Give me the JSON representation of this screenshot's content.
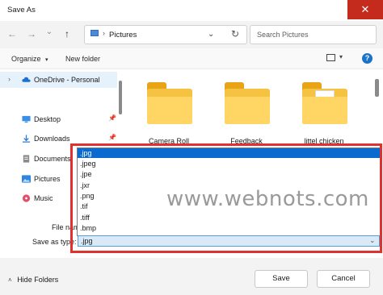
{
  "window": {
    "title": "Save As",
    "close_glyph": "✕"
  },
  "nav": {
    "back_glyph": "←",
    "forward_glyph": "→",
    "history_glyph": "⌄",
    "up_glyph": "↑",
    "address": {
      "separator": "›",
      "current": "Pictures",
      "dropdown_glyph": "⌄",
      "refresh_glyph": "↻"
    },
    "search": {
      "placeholder": "Search Pictures"
    }
  },
  "toolbar": {
    "organize": "Organize",
    "organize_caret": "▾",
    "new_folder": "New folder",
    "view_caret": "▾",
    "help_glyph": "?"
  },
  "sidebar": {
    "items": [
      {
        "label": "OneDrive - Personal",
        "chevron": "›",
        "icon": "cloud-icon",
        "color": "#1e6fd0",
        "pinned": false,
        "selected": true
      },
      {
        "label": "Desktop",
        "icon": "desktop-icon",
        "color": "#3a8ee6",
        "pinned": true
      },
      {
        "label": "Downloads",
        "icon": "download-icon",
        "color": "#2a7ad8",
        "pinned": true
      },
      {
        "label": "Documents",
        "icon": "document-icon",
        "color": "#7a7a7a",
        "pinned": true
      },
      {
        "label": "Pictures",
        "icon": "pictures-icon",
        "color": "#2e86de",
        "pinned": true
      },
      {
        "label": "Music",
        "icon": "music-icon",
        "color": "#e0506a",
        "pinned": true
      }
    ],
    "pin_glyph": "📌"
  },
  "folders": [
    {
      "label": "Camera Roll"
    },
    {
      "label": "Feedback"
    },
    {
      "label": "littel chicken"
    }
  ],
  "form": {
    "file_name_label": "File name:",
    "save_as_type_label": "Save as type:",
    "save_as_type_value": ".jpg",
    "dropdown_caret": "⌄",
    "type_options": [
      ".jpg",
      ".jpeg",
      ".jpe",
      ".jxr",
      ".png",
      ".tif",
      ".tiff",
      ".bmp"
    ],
    "selected_index": 0
  },
  "watermark": "www.webnots.com",
  "footer": {
    "hide_folders": "Hide Folders",
    "hide_caret": "˄",
    "save": "Save",
    "cancel": "Cancel"
  },
  "colors": {
    "accent": "#0b6acf",
    "highlight_border": "#e0302f",
    "folder": "#f5c242"
  }
}
